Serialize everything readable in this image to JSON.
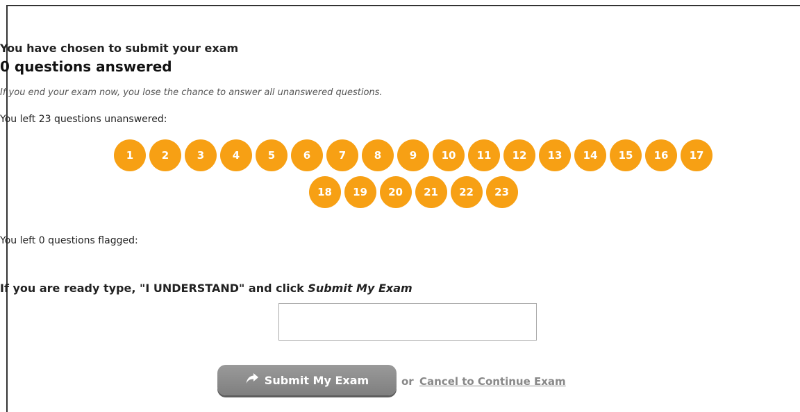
{
  "header": {
    "title": "You have chosen to submit your exam",
    "answered_summary": "0 questions answered",
    "warning": "If you end your exam now, you lose the chance to answer all unanswered questions."
  },
  "unanswered": {
    "label": "You left 23 questions unanswered:",
    "row1": [
      "1",
      "2",
      "3",
      "4",
      "5",
      "6",
      "7",
      "8",
      "9",
      "10",
      "11",
      "12",
      "13",
      "14",
      "15",
      "16",
      "17"
    ],
    "row2": [
      "18",
      "19",
      "20",
      "21",
      "22",
      "23"
    ]
  },
  "flagged": {
    "label": "You left 0 questions flagged:"
  },
  "confirm": {
    "instruction_prefix": "If you are ready type, \"I UNDERSTAND\" and click ",
    "instruction_emphasis": "Submit My Exam",
    "input_value": ""
  },
  "actions": {
    "submit_label": "Submit My Exam",
    "or_text": "or",
    "cancel_label": "Cancel to Continue Exam"
  },
  "colors": {
    "question_badge": "#f7a014",
    "submit_button": "#8c8c8c"
  }
}
